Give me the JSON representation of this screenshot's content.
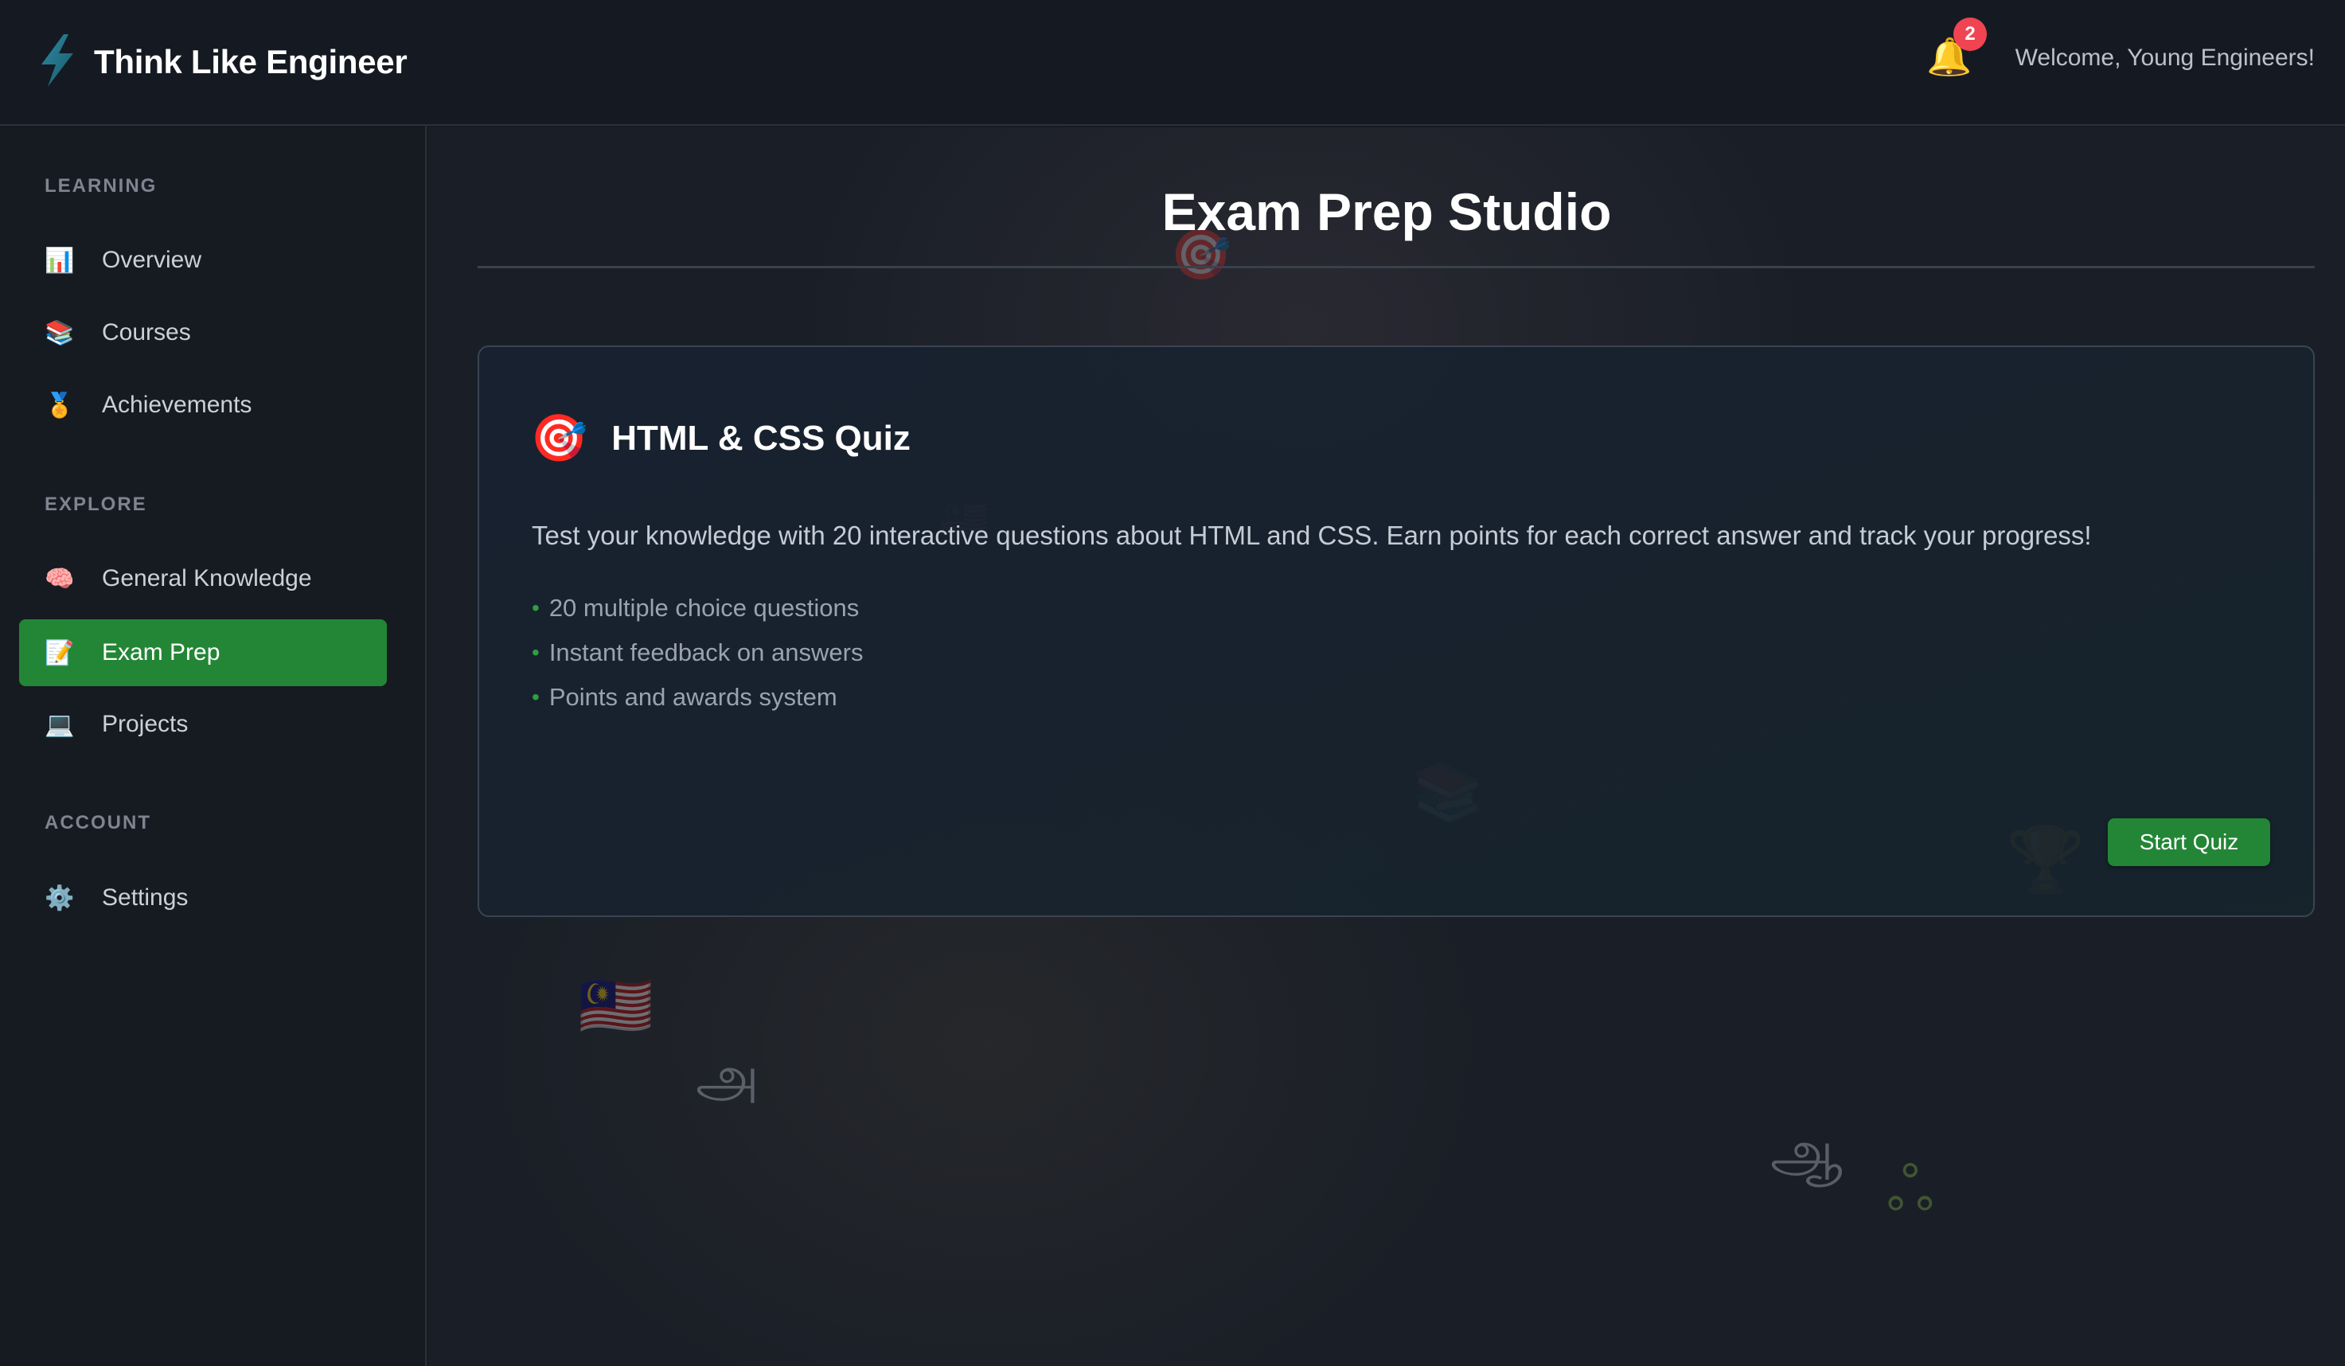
{
  "header": {
    "app_title": "Think Like Engineer",
    "logo_icon": "lightning-bolt-icon",
    "notifications": {
      "icon": "bell-icon",
      "glyph": "🔔",
      "count": "2"
    },
    "welcome_text": "Welcome, Young Engineers!"
  },
  "sidebar": {
    "sections": [
      {
        "label": "LEARNING"
      },
      {
        "label": "EXPLORE"
      },
      {
        "label": "ACCOUNT"
      }
    ],
    "items": [
      {
        "label": "Overview",
        "icon": "📊",
        "icon_name": "bar-chart-icon",
        "active": false
      },
      {
        "label": "Courses",
        "icon": "📚",
        "icon_name": "books-icon",
        "active": false
      },
      {
        "label": "Achievements",
        "icon": "🏅",
        "icon_name": "medal-icon",
        "active": false
      },
      {
        "label": "General Knowledge",
        "icon": "🧠",
        "icon_name": "brain-icon",
        "active": false
      },
      {
        "label": "Exam Prep",
        "icon": "📝",
        "icon_name": "memo-icon",
        "active": true
      },
      {
        "label": "Projects",
        "icon": "💻",
        "icon_name": "laptop-icon",
        "active": false
      },
      {
        "label": "Settings",
        "icon": "⚙️",
        "icon_name": "gear-icon",
        "active": false
      }
    ]
  },
  "main": {
    "page_title": "Exam Prep Studio",
    "quiz_card": {
      "icon": "🎯",
      "icon_name": "target-icon",
      "title": "HTML & CSS Quiz",
      "description": "Test your knowledge with 20 interactive questions about HTML and CSS. Earn points for each correct answer and track your progress!",
      "features": [
        "20 multiple choice questions",
        "Instant feedback on answers",
        "Points and awards system"
      ],
      "start_button": "Start Quiz"
    },
    "decorations": {
      "target": "🎯",
      "flag_small": "🇲🇾",
      "books": "📚",
      "trophy": "🏆",
      "flag": "🇲🇾",
      "tamil_a": "அ",
      "tamil_aa": "ஆ",
      "tamil_swirl": "ஃ"
    }
  },
  "colors": {
    "accent": "#238636",
    "badge": "#f04452",
    "background": "#161b22"
  }
}
